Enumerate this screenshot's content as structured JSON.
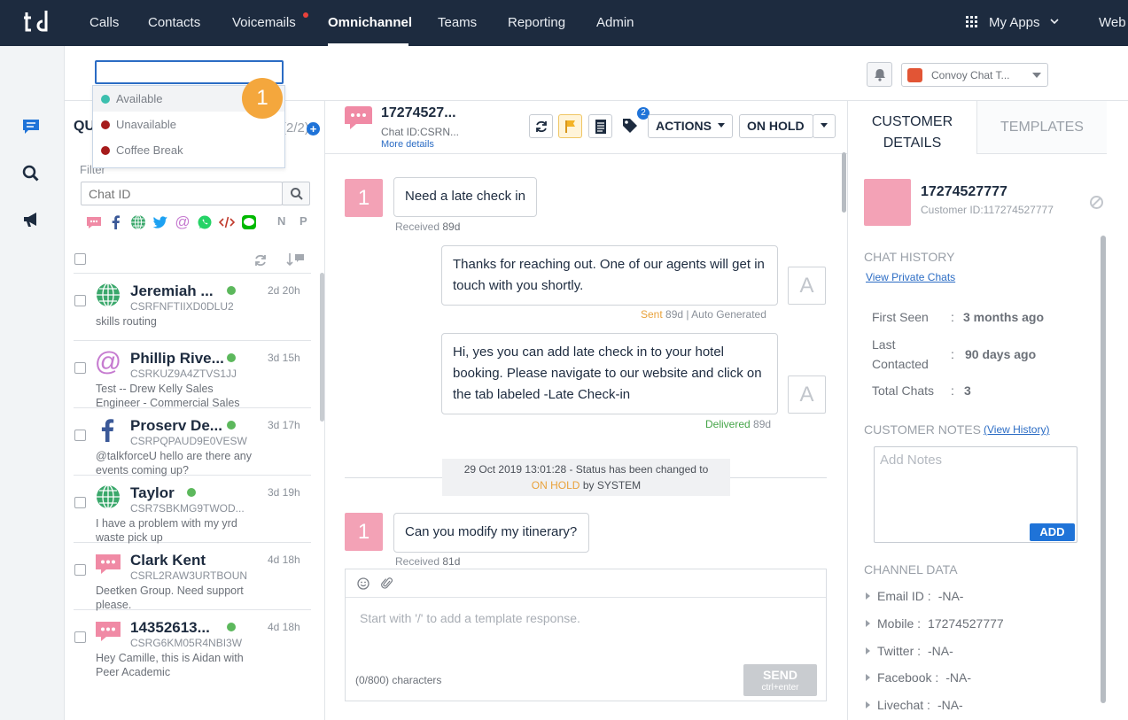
{
  "nav": {
    "items": [
      "Calls",
      "Contacts",
      "Voicemails",
      "Omnichannel",
      "Teams",
      "Reporting",
      "Admin"
    ],
    "active": "Omnichannel",
    "apps_label": "My Apps",
    "web_label": "Web"
  },
  "status": {
    "input_value": "",
    "options": [
      {
        "label": "Available",
        "color": "#3cbfae"
      },
      {
        "label": "Unavailable",
        "color": "#a61b1b"
      },
      {
        "label": "Coffee Break",
        "color": "#a61b1b"
      }
    ],
    "step_badge": "1"
  },
  "header": {
    "chat_selector_label": "Convoy Chat T..."
  },
  "queue": {
    "title": "QU",
    "count": "(2/2)",
    "filter_label": "Filter",
    "filter_placeholder": "Chat ID",
    "channel_letters": [
      "N",
      "P"
    ],
    "items": [
      {
        "name": "Jeremiah ...",
        "id": "CSRFNFTIIXD0DLU2",
        "time": "2d 20h",
        "preview": "skills routing",
        "channel": "globe"
      },
      {
        "name": "Phillip Rive...",
        "id": "CSRKUZ9A4ZTVS1JJ",
        "time": "3d 15h",
        "preview": "Test -- Drew Kelly Sales Engineer - Commercial Sales",
        "channel": "email"
      },
      {
        "name": "Proserv De...",
        "id": "CSRPQPAUD9E0VESW",
        "time": "3d 17h",
        "preview": "@talkforceU hello are there any events coming up?",
        "channel": "facebook"
      },
      {
        "name": "Taylor",
        "id": "CSR7SBKMG9TWOD...",
        "time": "3d 19h",
        "preview": "I have a problem with my yrd waste pick up",
        "channel": "globe"
      },
      {
        "name": "Clark Kent",
        "id": "CSRL2RAW3URTBOUN",
        "time": "4d 18h",
        "preview": "Deetken Group. Need support please.",
        "channel": "sms"
      },
      {
        "name": "14352613...",
        "id": "CSRG6KM05R4NBI3W",
        "time": "4d 18h",
        "preview": "Hey Camille, this is Aidan with Peer Academic",
        "channel": "sms"
      }
    ]
  },
  "chat": {
    "title": "17274527...",
    "chat_id": "Chat ID:CSRN...",
    "more_details": "More details",
    "tag_count": "2",
    "actions_label": "ACTIONS",
    "hold_label": "ON HOLD",
    "messages": [
      {
        "type": "in",
        "avatar": "1",
        "text": "Need a late check in",
        "meta_label": "Received",
        "meta_time": "89d"
      },
      {
        "type": "out",
        "avatar": "A",
        "text": "Thanks for reaching out. One of our agents will get in touch with you shortly.",
        "meta_status": "Sent",
        "meta_rest": "89d | Auto Generated"
      },
      {
        "type": "out",
        "avatar": "A",
        "text": "Hi, yes you can add late check in to your hotel booking. Please navigate to our website and click on the tab labeled -Late Check-in",
        "meta_status": "Delivered",
        "meta_rest": "89d"
      },
      {
        "type": "in",
        "avatar": "1",
        "text": "Can you modify my itinerary?",
        "meta_label": "Received",
        "meta_time": "81d"
      }
    ],
    "system": {
      "line1": "29 Oct 2019 13:01:28 - Status has been changed to",
      "status": "ON HOLD",
      "by": "by SYSTEM"
    },
    "composer": {
      "placeholder": "Start with '/' to add a template response.",
      "count": "(0/800) characters",
      "send": "SEND",
      "send_hint": "ctrl+enter"
    }
  },
  "right": {
    "tab_active_line1": "CUSTOMER",
    "tab_active_line2": "DETAILS",
    "tab_inactive": "TEMPLATES",
    "customer_name": "17274527777",
    "customer_id": "Customer ID:117274527777",
    "chat_history_title": "CHAT HISTORY",
    "private_chats_link": "View Private Chats",
    "first_seen_label": "First Seen",
    "first_seen_value": "3 months ago",
    "last_contacted_label_1": "Last",
    "last_contacted_label_2": "Contacted",
    "last_contacted_value": "90 days ago",
    "total_chats_label": "Total Chats",
    "total_chats_value": "3",
    "notes_title": "CUSTOMER NOTES",
    "history_link": "(View History)",
    "notes_placeholder": "Add Notes",
    "add_label": "ADD",
    "channel_data_title": "CHANNEL DATA",
    "channels": [
      {
        "label": "Email ID",
        "value": "-NA-"
      },
      {
        "label": "Mobile",
        "value": "17274527777"
      },
      {
        "label": "Twitter",
        "value": "-NA-"
      },
      {
        "label": "Facebook",
        "value": "-NA-"
      },
      {
        "label": "Livechat",
        "value": "-NA-"
      }
    ]
  },
  "colors": {
    "nav_bg": "#1d2b3f",
    "accent_blue": "#1f73d8",
    "step_badge": "#f4a73d",
    "customer_pink": "#f3a2b6",
    "online_green": "#5cb85c"
  }
}
